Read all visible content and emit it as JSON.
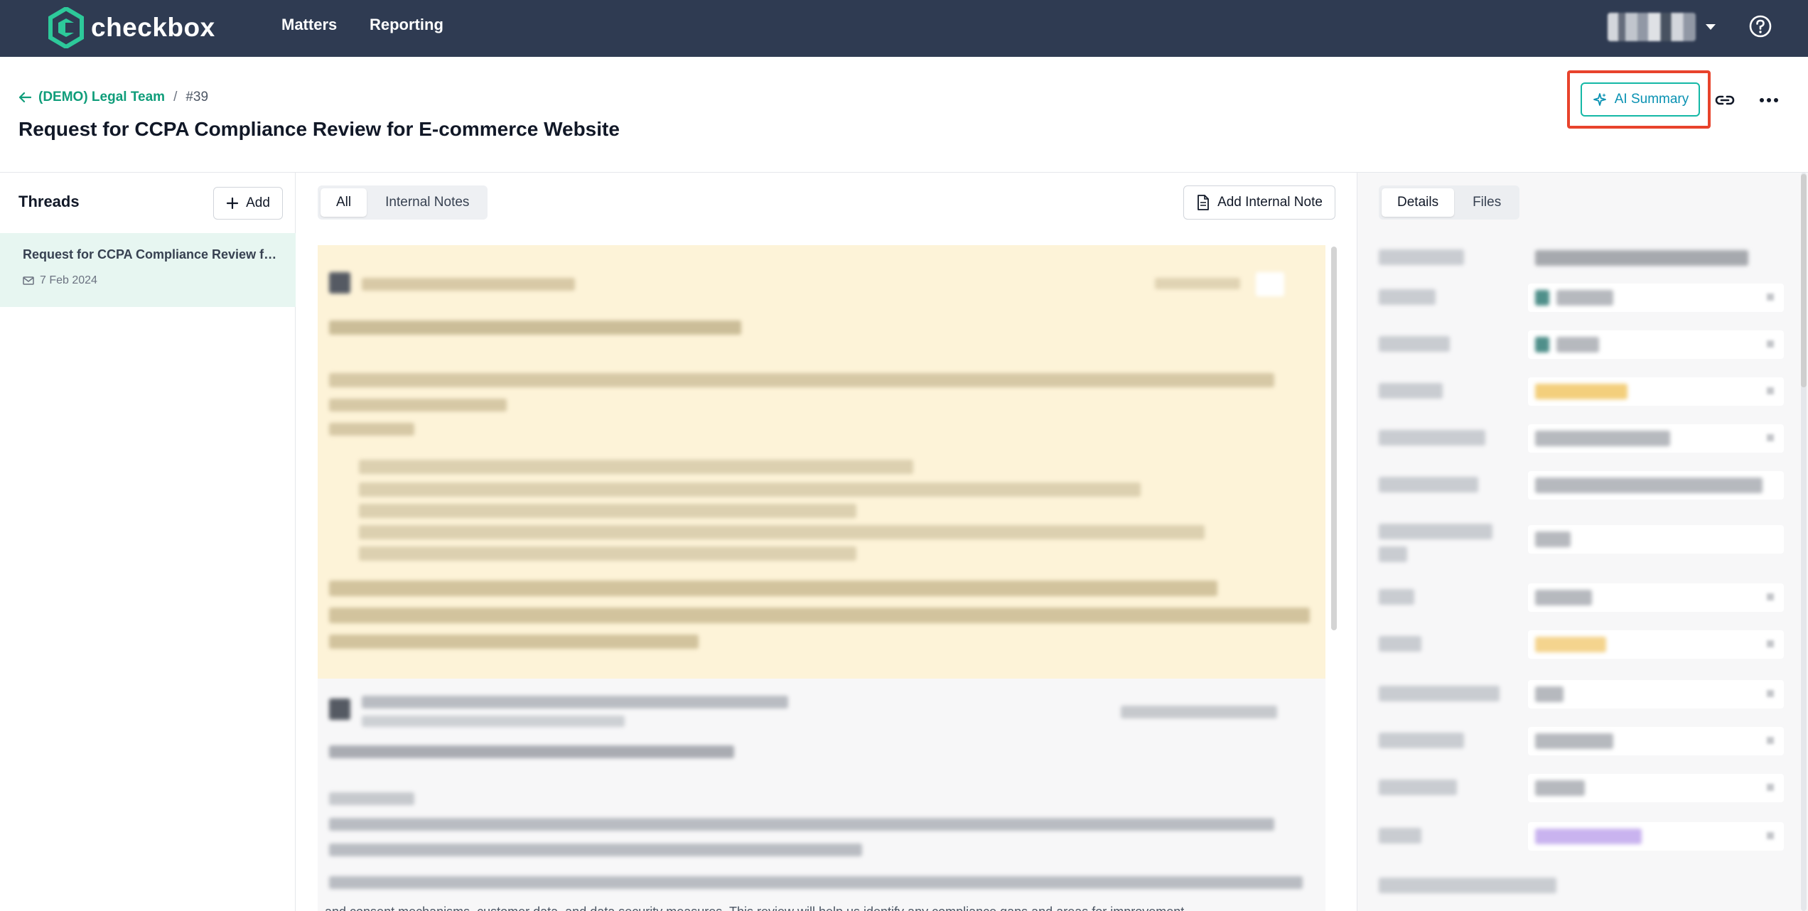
{
  "brand": {
    "name": "checkbox",
    "accent": "#2dc99a"
  },
  "nav": {
    "matters": "Matters",
    "reporting": "Reporting"
  },
  "breadcrumb": {
    "team": "(DEMO) Legal Team",
    "separator": "/",
    "id": "#39"
  },
  "page": {
    "title": "Request for CCPA Compliance Review for E-commerce Website"
  },
  "actions": {
    "ai_summary": "AI Summary"
  },
  "threads": {
    "title": "Threads",
    "add_label": "Add",
    "items": [
      {
        "title": "Request for CCPA Compliance Review for E-commerce Website",
        "date": "7 Feb 2024"
      }
    ]
  },
  "messages": {
    "tabs": [
      "All",
      "Internal Notes"
    ],
    "active_tab": "All",
    "add_internal_note": "Add Internal Note",
    "visible_text_fragment": "and consent mechanisms, customer data, and data security measures. This review will help us identify any compliance gaps and areas for improvement."
  },
  "details": {
    "tabs": [
      "Details",
      "Files"
    ],
    "active_tab": "Details"
  },
  "colors": {
    "topbar": "#2f3b52",
    "highlight": "#e8432c",
    "ai_button": "#14b8a6",
    "thread_active": "#e7f6f1",
    "message_yellow": "#fdf3d8"
  }
}
